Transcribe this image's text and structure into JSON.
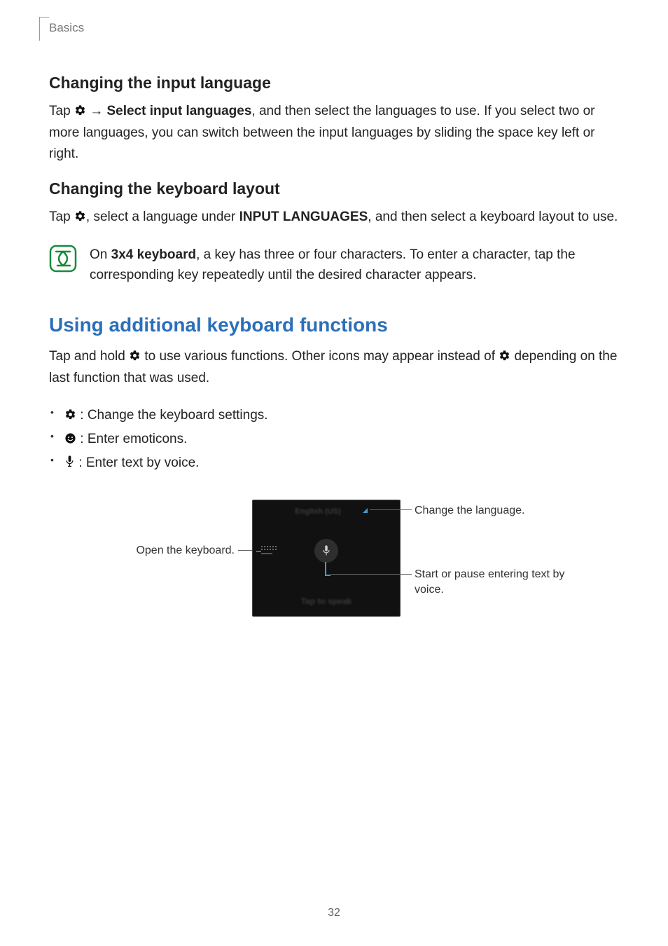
{
  "running_header": "Basics",
  "h_input_lang": "Changing the input language",
  "p_input_lang_pre": "Tap ",
  "p_input_lang_arrow": " → ",
  "p_input_lang_bold": "Select input languages",
  "p_input_lang_post": ", and then select the languages to use. If you select two or more languages, you can switch between the input languages by sliding the space key left or right.",
  "h_kbd_layout": "Changing the keyboard layout",
  "p_kbd_layout_pre": "Tap ",
  "p_kbd_layout_mid": ", select a language under ",
  "p_kbd_layout_bold": "INPUT LANGUAGES",
  "p_kbd_layout_post": ", and then select a keyboard layout to use.",
  "note_pre": "On ",
  "note_bold": "3x4 keyboard",
  "note_post": ", a key has three or four characters. To enter a character, tap the corresponding key repeatedly until the desired character appears.",
  "h_additional": "Using additional keyboard functions",
  "p_additional_pre": "Tap and hold ",
  "p_additional_mid": " to use various functions. Other icons may appear instead of ",
  "p_additional_post": " depending on the last function that was used.",
  "li_gear": " : Change the keyboard settings.",
  "li_emo": " : Enter emoticons.",
  "li_mic": " : Enter text by voice.",
  "call_open_kbd": "Open the keyboard.",
  "call_change_lang": "Change the language.",
  "call_voice": "Start or pause entering text by voice.",
  "panel_top": "English (US)",
  "panel_bottom": "Tap to speak",
  "page_number": "32"
}
